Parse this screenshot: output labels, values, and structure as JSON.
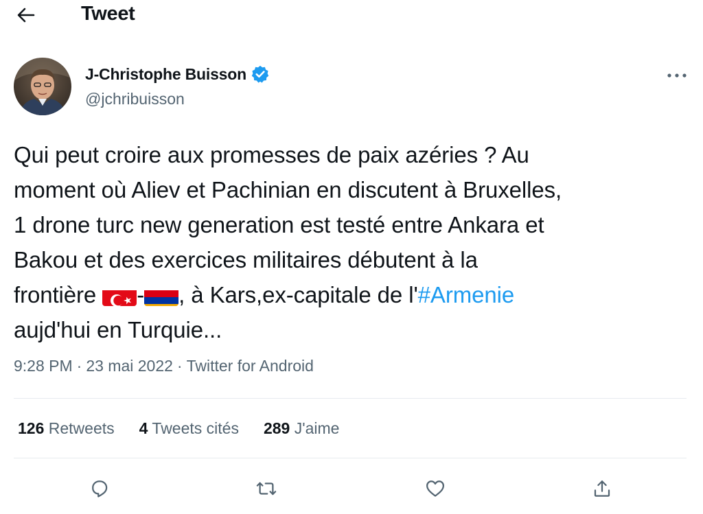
{
  "header": {
    "title": "Tweet",
    "back_icon": "arrow-left-icon"
  },
  "tweet": {
    "author_name": "J-Christophe Buisson",
    "author_handle": "@jchribuisson",
    "verified_icon": "verified-badge-icon",
    "text_lines": [
      "Qui peut croire aux promesses de paix azéries ? Au",
      "moment où Aliev et Pachinian en discutent à Bruxelles,",
      "1 drone turc new generation est testé entre Ankara et",
      "Bakou et des exercices militaires débutent à la"
    ],
    "line5_before": "frontière ",
    "line5_dash": "-",
    "line5_after": ", à Kars,ex-capitale de l'",
    "hashtag": "#Armenie",
    "last_line": "aujd'hui en Turquie...",
    "flags": [
      "turkey-flag-icon",
      "armenia-flag-icon"
    ],
    "time": "9:28 PM",
    "date": "23 mai 2022",
    "meta_sep": "·",
    "source": "Twitter for Android"
  },
  "stats": {
    "retweets_count": "126",
    "retweets_label": "Retweets",
    "quotes_count": "4",
    "quotes_label": "Tweets cités",
    "likes_count": "289",
    "likes_label": "J'aime"
  },
  "actions": [
    "reply-icon",
    "retweet-icon",
    "like-icon",
    "share-icon"
  ],
  "colors": {
    "text": "#0f1419",
    "secondary": "#536471",
    "accent": "#1d9bf0",
    "divider": "#e7ebef"
  }
}
